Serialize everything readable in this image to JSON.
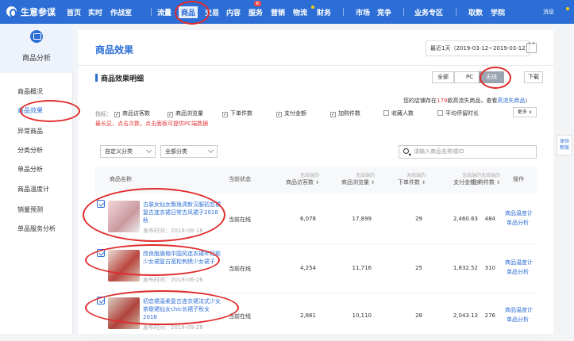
{
  "topbar": {
    "brand": "生意参谋",
    "nav": [
      "首页",
      "实时",
      "作战室",
      "流量",
      "商品",
      "交易",
      "内容",
      "服务",
      "营销",
      "物流",
      "财务",
      "市场",
      "竞争",
      "业务专区",
      "取数",
      "学院"
    ],
    "hot_badge": "服务",
    "message": "消息"
  },
  "sidebar": {
    "title": "商品分析",
    "items": [
      "商品概况",
      "商品效果",
      "异常商品",
      "分类分析",
      "单品分析",
      "商品温度计",
      "销量预测",
      "单品服务分析"
    ]
  },
  "main": {
    "title": "商品效果",
    "date_range": "最近1天（2019-03-12~2019-03-12）",
    "section_title": "商品效果明细",
    "segments": [
      "全部",
      "PC",
      "无线"
    ],
    "download": "下载",
    "note": {
      "prefix": "您的店铺存在",
      "count": "179",
      "middle": "款高流失商品，查看",
      "link": "高流失商品",
      "suffix": "）"
    },
    "indicator_label": "指标：",
    "indicators": [
      {
        "label": "商品访客数",
        "checked": true
      },
      {
        "label": "商品浏览量",
        "checked": true
      },
      {
        "label": "下单件数",
        "checked": true
      },
      {
        "label": "支付金额",
        "checked": true
      },
      {
        "label": "加购件数",
        "checked": true
      },
      {
        "label": "收藏人数",
        "checked": false
      },
      {
        "label": "平均停留时长",
        "checked": false
      }
    ],
    "more": "更多",
    "warning": "最长显，点击次数，点击面板可提供PC端数据",
    "filter_custom": "自定义分类",
    "filter_all": "全部分类",
    "search_placeholder": "请输入商品名称或ID"
  },
  "table": {
    "columns": [
      {
        "main": "商品名称",
        "sub": ""
      },
      {
        "main": "当前状态",
        "sub": ""
      },
      {
        "main": "商品访客数",
        "sub": "无线端的"
      },
      {
        "main": "商品浏览量",
        "sub": "无线端的"
      },
      {
        "main": "下单件数",
        "sub": "无线端的"
      },
      {
        "main": "支付金额",
        "sub": "无线端的"
      },
      {
        "main": "加购件数",
        "sub": "无线端的"
      },
      {
        "main": "操作",
        "sub": ""
      }
    ],
    "rows": [
      {
        "name": "古装女仙女飘逸清新汉服初恋裙复古连衣裙日常古风裙子2018秋",
        "published": "发布时间：2018-08-18",
        "status": "当前在线",
        "visitors": "6,078",
        "views": "17,899",
        "orders": "29",
        "payment": "2,460.63",
        "carts": "484",
        "op1": "商品温度计",
        "op2": "单品分析"
      },
      {
        "name": "改良版旗袍中国风连衣裙年轻款少女裙复古宽松刺绣少女裙子",
        "published": "发布时间：2018-06-26",
        "status": "当前在线",
        "visitors": "4,254",
        "views": "11,716",
        "orders": "25",
        "payment": "1,832.52",
        "carts": "310",
        "op1": "商品温度计",
        "op2": "单品分析"
      },
      {
        "name": "初恋裙温柔复古连衣裙法式少女茶歇裙仙女chic长裙子秋女2018",
        "published": "发布时间：2018-09-28",
        "status": "当前在线",
        "visitors": "2,861",
        "views": "10,110",
        "orders": "28",
        "payment": "2,043.13",
        "carts": "276",
        "op1": "商品温度计",
        "op2": "单品分析"
      }
    ]
  },
  "float_tab": [
    "体验",
    "新版"
  ],
  "colors": {
    "primary": "#2c6ed5",
    "annotation": "#e12b2b",
    "warning": "#e4393c"
  }
}
